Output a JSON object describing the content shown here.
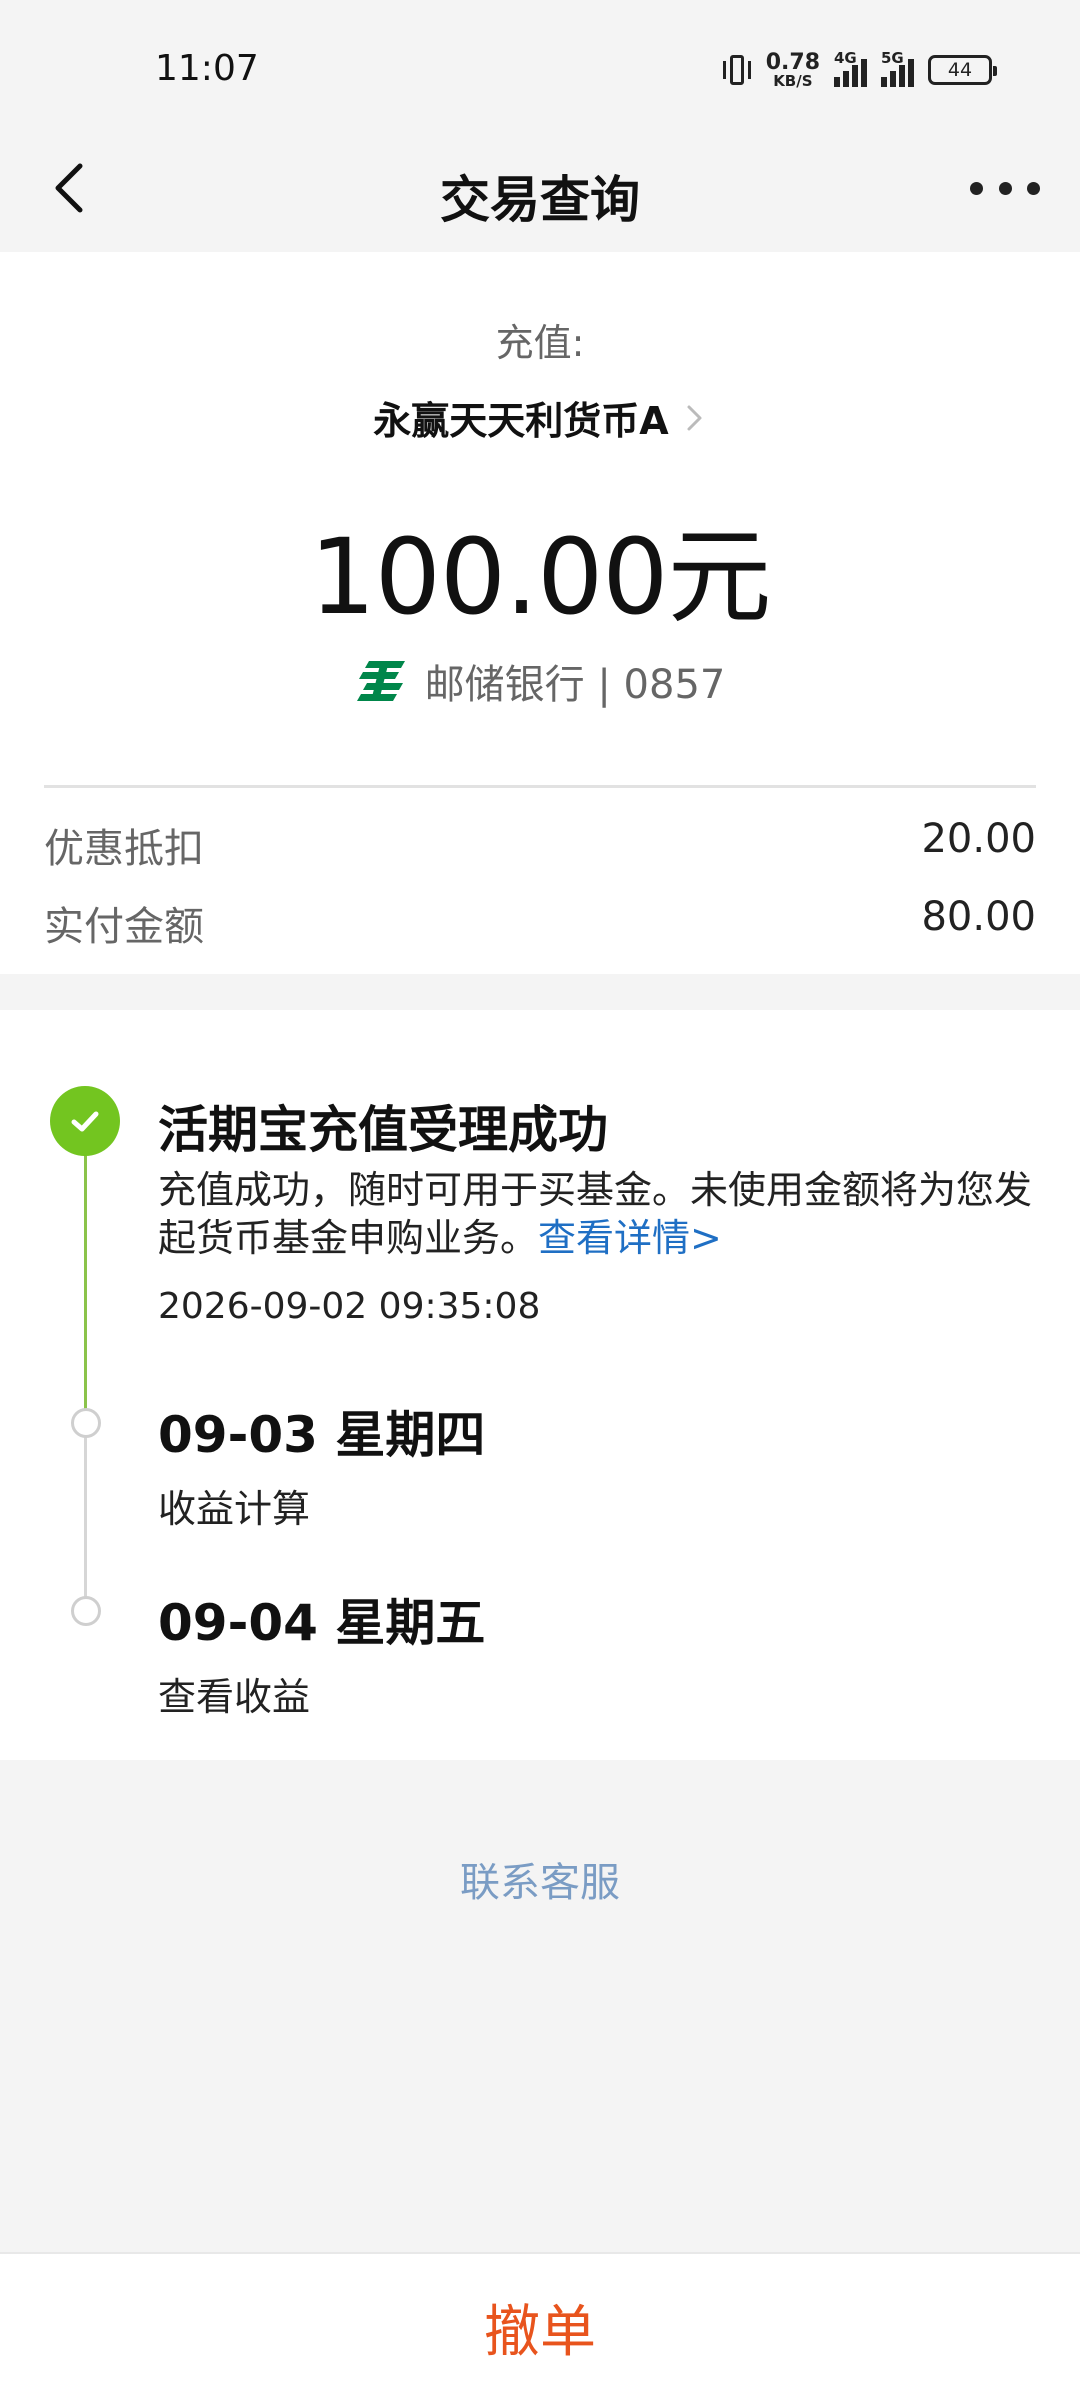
{
  "status_bar": {
    "time": "11:07",
    "net_speed_value": "0.78",
    "net_speed_unit": "KB/S",
    "signal_1_tag": "4G",
    "signal_2_tag": "5G",
    "battery": "44"
  },
  "nav": {
    "title": "交易查询",
    "back_icon": "chevron-left-icon",
    "more_icon": "more-icon"
  },
  "summary": {
    "type_label": "充值:",
    "fund_name": "永赢天天利货币A",
    "amount": "100.00元",
    "bank_label": "邮储银行 | 0857",
    "bank_logo_color": "#00864a",
    "rows": [
      {
        "label": "优惠抵扣",
        "value": "20.00"
      },
      {
        "label": "实付金额",
        "value": "80.00"
      }
    ]
  },
  "timeline": {
    "steps": [
      {
        "title": "活期宝充值受理成功",
        "desc": "充值成功，随时可用于买基金。未使用金额将为您发起货币基金申购业务。",
        "link": "查看详情>",
        "time": "2026-09-02 09:35:08"
      },
      {
        "title": "09-03 星期四",
        "sub": "收益计算"
      },
      {
        "title": "09-04 星期五",
        "sub": "查看收益"
      }
    ],
    "done_color": "#73c520",
    "line_color": "#8bc34a"
  },
  "contact_label": "联系客服",
  "cancel_label": "撤单",
  "colors": {
    "link": "#1f6fc4",
    "cancel": "#e8541d",
    "contact": "#7a9cc4"
  }
}
